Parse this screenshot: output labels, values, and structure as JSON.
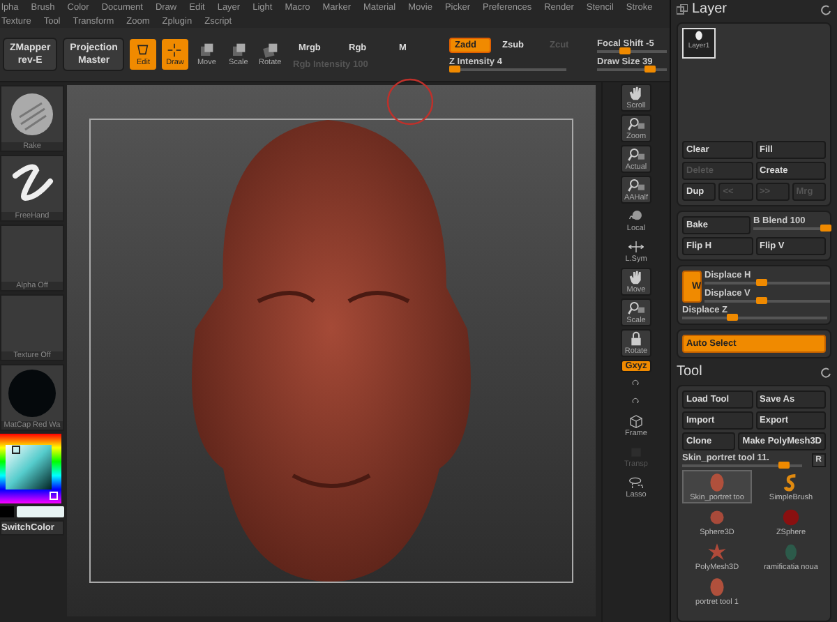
{
  "menu_rows": [
    [
      "lpha",
      "Brush",
      "Color",
      "Document",
      "Draw",
      "Edit",
      "Layer",
      "Light",
      "Macro",
      "Marker",
      "Material",
      "Movie",
      "Picker",
      "Preferences",
      "Render",
      "Stencil",
      "Stroke"
    ],
    [
      "Texture",
      "Tool",
      "Transform",
      "Zoom",
      "Zplugin",
      "Zscript"
    ]
  ],
  "toolbar": {
    "plugins": [
      {
        "line1": "ZMapper",
        "line2": "rev-E"
      },
      {
        "line1": "Projection",
        "line2": "Master"
      }
    ],
    "modes": [
      {
        "label": "Edit",
        "kind": "edit",
        "on": true
      },
      {
        "label": "Draw",
        "kind": "draw",
        "on": true
      },
      {
        "label": "Move",
        "kind": "move",
        "on": false
      },
      {
        "label": "Scale",
        "kind": "scale",
        "on": false
      },
      {
        "label": "Rotate",
        "kind": "rotate",
        "on": false
      }
    ],
    "channels": [
      {
        "label": "Mrgb",
        "selected": false
      },
      {
        "label": "Rgb",
        "selected": false
      },
      {
        "label": "M",
        "selected": false
      }
    ],
    "rgb_intensity": {
      "label": "Rgb Intensity",
      "value": "100",
      "disabled": true
    },
    "z_modes": [
      {
        "label": "Zadd",
        "selected": true,
        "disabled": false
      },
      {
        "label": "Zsub",
        "selected": false,
        "disabled": false
      },
      {
        "label": "Zcut",
        "selected": false,
        "disabled": true
      }
    ],
    "z_intensity": {
      "label": "Z Intensity",
      "value": "4",
      "level": 0.05
    },
    "focal_shift": {
      "label": "Focal Shift",
      "value": "-5",
      "level": 0.4
    },
    "draw_size": {
      "label": "Draw Size",
      "value": "39",
      "level": 0.75
    }
  },
  "shelf": [
    {
      "label": "Rake",
      "kind": "rake"
    },
    {
      "label": "FreeHand",
      "kind": "stroke"
    },
    {
      "label": "Alpha Off",
      "kind": "empty"
    },
    {
      "label": "Texture Off",
      "kind": "empty"
    },
    {
      "label": "MatCap Red Wa",
      "kind": "matcap"
    }
  ],
  "switch_color": "SwitchColor",
  "nav": [
    {
      "label": "Scroll",
      "kind": "hand",
      "framed": true,
      "active": false,
      "disabled": false
    },
    {
      "label": "Zoom",
      "kind": "magnifier",
      "framed": true,
      "active": false,
      "disabled": false
    },
    {
      "label": "Actual",
      "kind": "magnifier",
      "framed": true,
      "active": false,
      "disabled": false
    },
    {
      "label": "AAHalf",
      "kind": "magnifier",
      "framed": true,
      "active": false,
      "disabled": false
    },
    {
      "label": "Local",
      "kind": "sphere",
      "framed": false,
      "active": false,
      "disabled": false
    },
    {
      "label": "L.Sym",
      "kind": "arrows",
      "framed": false,
      "active": false,
      "disabled": false
    },
    {
      "label": "Move",
      "kind": "hand",
      "framed": true,
      "active": false,
      "disabled": false
    },
    {
      "label": "Scale",
      "kind": "magnifier",
      "framed": true,
      "active": false,
      "disabled": false
    },
    {
      "label": "Rotate",
      "kind": "lock",
      "framed": true,
      "active": false,
      "disabled": false
    },
    {
      "label": "Gxyz",
      "kind": "text",
      "framed": true,
      "active": true,
      "disabled": false
    },
    {
      "kind": "rotate",
      "framed": false,
      "active": false,
      "disabled": false
    },
    {
      "kind": "rotate",
      "framed": false,
      "active": false,
      "disabled": false
    },
    {
      "label": "Frame",
      "kind": "cube",
      "framed": false,
      "active": false,
      "disabled": false
    },
    {
      "label": "Transp",
      "kind": "layers",
      "framed": false,
      "active": false,
      "disabled": true
    },
    {
      "label": "Lasso",
      "kind": "lasso",
      "framed": false,
      "active": false,
      "disabled": false
    }
  ],
  "layer_panel": {
    "title": "Layer",
    "layers": [
      {
        "label": "Layer1",
        "selected": true
      }
    ],
    "button_rows": [
      [
        {
          "label": "Clear",
          "disabled": false
        },
        {
          "label": "Fill",
          "disabled": false
        }
      ],
      [
        {
          "label": "Delete",
          "disabled": true
        },
        {
          "label": "Create",
          "disabled": false
        }
      ],
      [
        {
          "label": "Dup",
          "disabled": false
        },
        {
          "label": "<<",
          "disabled": true
        },
        {
          "label": ">>",
          "disabled": true
        },
        {
          "label": "Mrg",
          "disabled": true
        }
      ]
    ],
    "bake": {
      "label": "Bake"
    },
    "b_blend": {
      "label": "B Blend",
      "value": "100",
      "level": 1
    },
    "flips": [
      "Flip H",
      "Flip V"
    ],
    "wrap": {
      "label": "W",
      "on": true
    },
    "displace": [
      {
        "label": "Displace H",
        "level": 0.45
      },
      {
        "label": "Displace V",
        "level": 0.45
      },
      {
        "label": "Displace Z",
        "level": 0.35
      }
    ],
    "auto_select": {
      "label": "Auto Select",
      "on": true
    }
  },
  "tool_panel": {
    "title": "Tool",
    "button_rows": [
      [
        "Load Tool",
        "Save As"
      ],
      [
        "Import",
        "Export"
      ],
      [
        "Clone",
        "Make PolyMesh3D"
      ]
    ],
    "current": {
      "label": "Skin_portret tool 11.",
      "level": 0.85
    },
    "r_button": "R",
    "tools": [
      {
        "label": "Skin_portret too",
        "kind": "head",
        "selected": true
      },
      {
        "label": "SimpleBrush",
        "kind": "brush",
        "selected": false
      },
      {
        "label": "Sphere3D",
        "kind": "sphere",
        "selected": false
      },
      {
        "label": "ZSphere",
        "kind": "zsphere",
        "selected": false
      },
      {
        "label": "PolyMesh3D",
        "kind": "star",
        "selected": false
      },
      {
        "label": "ramificatia noua",
        "kind": "darkhead",
        "selected": false
      },
      {
        "label": "portret tool 1",
        "kind": "head",
        "selected": false
      }
    ]
  }
}
